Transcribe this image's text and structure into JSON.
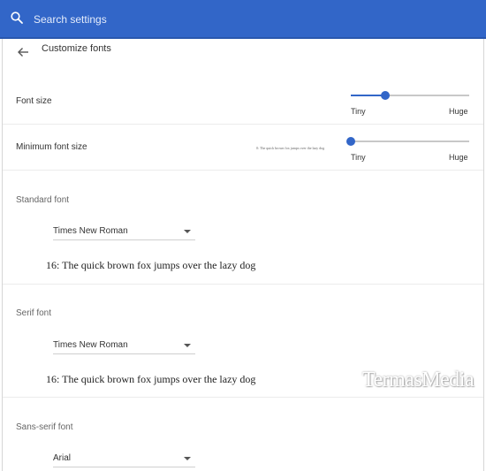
{
  "search": {
    "placeholder": "Search settings"
  },
  "header": {
    "title": "Customize fonts"
  },
  "font_size": {
    "label": "Font size",
    "min_label": "Tiny",
    "max_label": "Huge",
    "level": 0.29
  },
  "minimum_font_size": {
    "label": "Minimum font size",
    "preview": "0: The quick brown fox jumps over the lazy dog",
    "min_label": "Tiny",
    "max_label": "Huge",
    "level": 0.0
  },
  "standard_font": {
    "title": "Standard font",
    "selected": "Times New Roman",
    "sample": "16: The quick brown fox jumps over the lazy dog"
  },
  "serif_font": {
    "title": "Serif font",
    "selected": "Times New Roman",
    "sample": "16: The quick brown fox jumps over the lazy dog"
  },
  "sans_serif_font": {
    "title": "Sans-serif font",
    "selected": "Arial"
  },
  "watermark": "TermasMedia",
  "colors": {
    "accent": "#3266c8",
    "track": "#c8c8c8",
    "divider": "#ececec"
  }
}
